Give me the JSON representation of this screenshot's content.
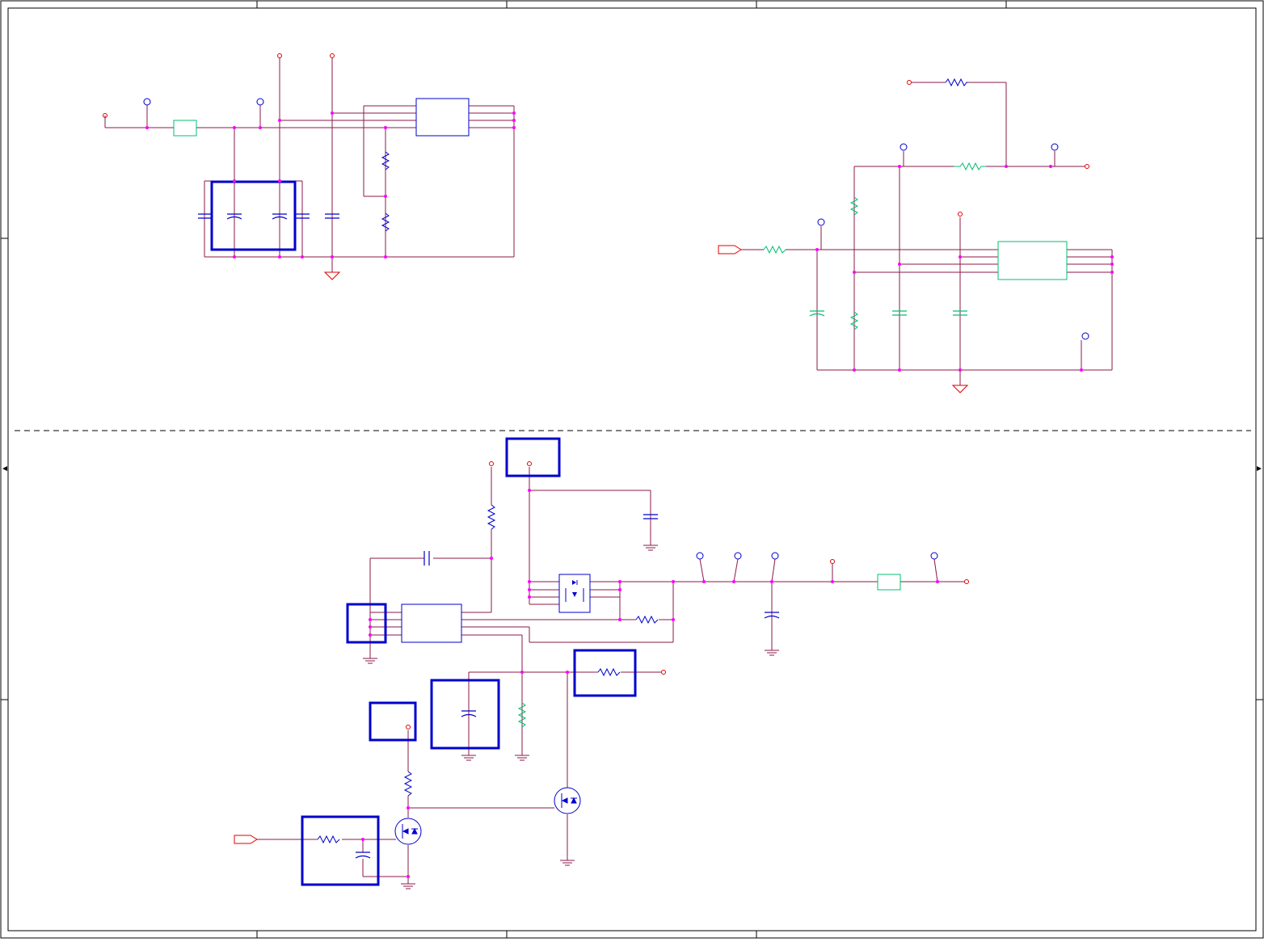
{
  "sheet": {
    "title": "",
    "colors": {
      "wire": "#8b1a4a",
      "junction": "#ff00ff",
      "component_blue": "#0000cc",
      "component_green": "#00c070",
      "port_red": "#e00000",
      "frame": "#000000"
    },
    "icons": [
      "power-rail-icon",
      "test-point-icon",
      "ground-icon",
      "resistor-icon",
      "capacitor-icon",
      "mosfet-icon",
      "ic-block-icon",
      "ferrite-bead-icon",
      "offpage-connector-icon"
    ]
  }
}
